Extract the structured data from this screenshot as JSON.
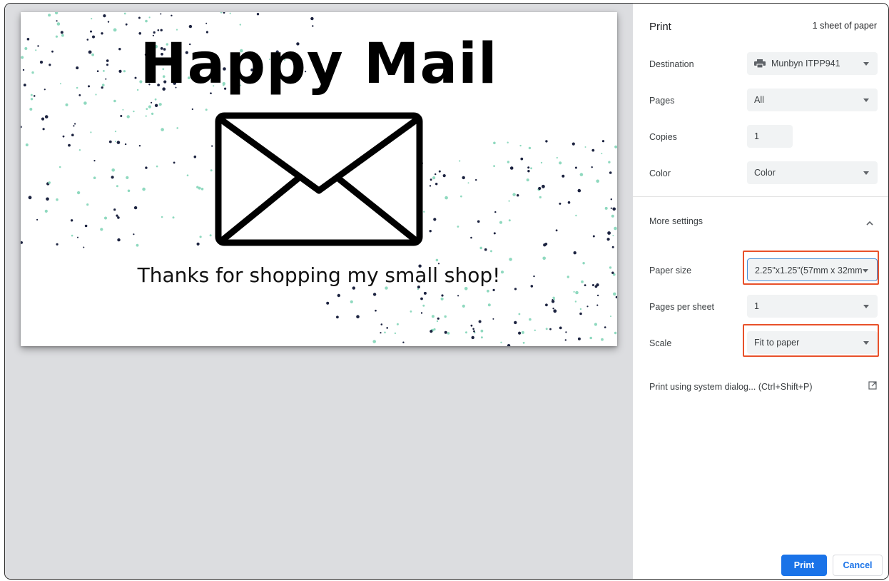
{
  "preview": {
    "headline": "Happy Mail",
    "tagline": "Thanks for shopping my small shop!"
  },
  "panel": {
    "title": "Print",
    "sheet_count": "1 sheet of paper",
    "destination": {
      "label": "Destination",
      "value": "Munbyn ITPP941",
      "icon": "printer-icon"
    },
    "pages": {
      "label": "Pages",
      "value": "All"
    },
    "copies": {
      "label": "Copies",
      "value": "1"
    },
    "color": {
      "label": "Color",
      "value": "Color"
    },
    "more_settings": {
      "label": "More settings",
      "icon": "chevron-up-icon"
    },
    "paper_size": {
      "label": "Paper size",
      "value": "2.25\"x1.25\"(57mm x 32mm"
    },
    "pages_per_sheet": {
      "label": "Pages per sheet",
      "value": "1"
    },
    "scale": {
      "label": "Scale",
      "value": "Fit to paper"
    },
    "system_dialog": {
      "label": "Print using system dialog... (Ctrl+Shift+P)",
      "icon": "open-external-icon"
    },
    "print_button": "Print",
    "cancel_button": "Cancel"
  },
  "colors": {
    "accent": "#1a73e8",
    "highlight_box": "#e8512a",
    "preview_bg": "#dcdde0",
    "confetti_dark": "#1c2340",
    "confetti_mint": "#8fd9bf"
  }
}
